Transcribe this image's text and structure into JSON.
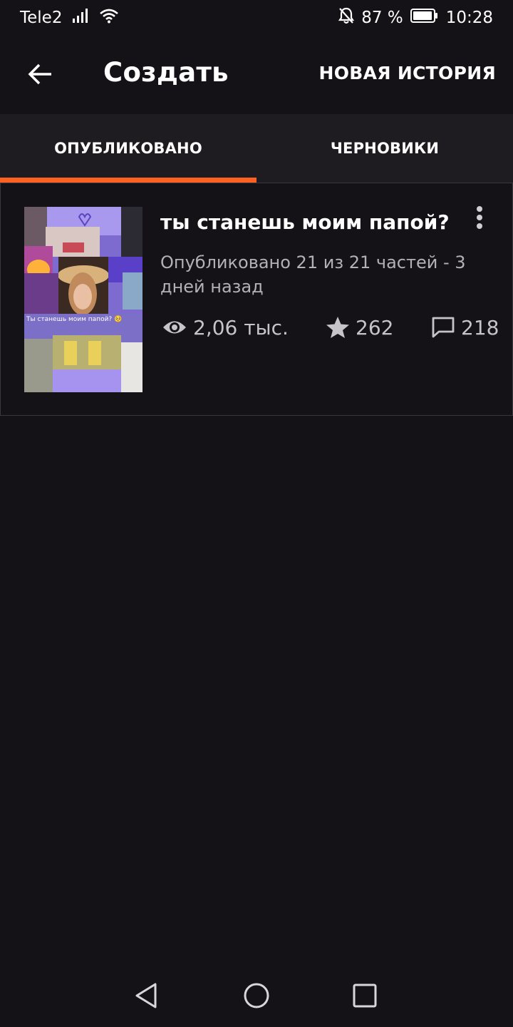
{
  "status_bar": {
    "carrier": "Tele2",
    "battery_percent": "87 %",
    "time": "10:28"
  },
  "app_bar": {
    "title": "Создать",
    "new_story_label": "НОВАЯ ИСТОРИЯ"
  },
  "tabs": [
    {
      "label": "ОПУБЛИКОВАНО",
      "active": true
    },
    {
      "label": "ЧЕРНОВИКИ",
      "active": false
    }
  ],
  "accent_color": "#ff6122",
  "stories": [
    {
      "title": "ты станешь моим папой?",
      "published_line_1": "Опубликовано 21 из 21 частей - 3",
      "published_line_2": "дней назад",
      "views": "2,06 тыс.",
      "votes": "262",
      "comments": "218",
      "cover_caption": "Ты станешь моим папой? 🥺"
    }
  ]
}
